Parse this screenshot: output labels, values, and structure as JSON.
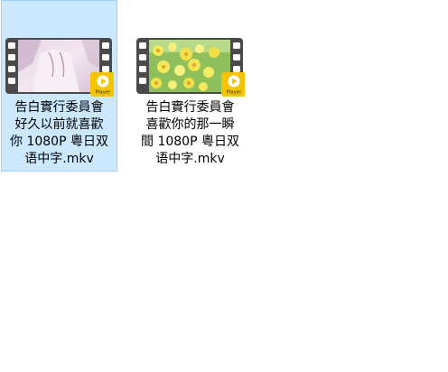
{
  "files": [
    {
      "name_lines": [
        "告白實行委員會",
        "好久以前就喜歡",
        "你 1080P 粵日双",
        "语中字.mkv"
      ],
      "selected": true,
      "badge_label": "Player",
      "thumbnail_icon": "video-file-icon"
    },
    {
      "name_lines": [
        "告白實行委員會",
        "喜歡你的那一瞬",
        "間 1080P 粵日双",
        "语中字.mkv"
      ],
      "selected": false,
      "badge_label": "Player",
      "thumbnail_icon": "video-file-icon"
    }
  ],
  "colors": {
    "selection_background": "#cce8ff",
    "selection_border": "#99d1ff",
    "film_strip": "#4a4a4a",
    "badge_yellow": "#f5c400"
  }
}
